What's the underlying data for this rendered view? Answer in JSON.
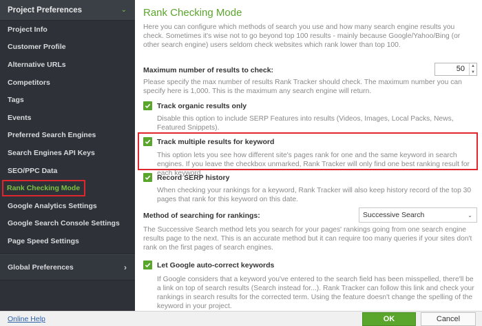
{
  "sidebar": {
    "header": "Project Preferences",
    "items": [
      {
        "label": "Project Info"
      },
      {
        "label": "Customer Profile"
      },
      {
        "label": "Alternative URLs"
      },
      {
        "label": "Competitors"
      },
      {
        "label": "Tags"
      },
      {
        "label": "Events"
      },
      {
        "label": "Preferred Search Engines"
      },
      {
        "label": "Search Engines API Keys"
      },
      {
        "label": "SEO/PPC Data"
      },
      {
        "label": "Rank Checking Mode"
      },
      {
        "label": "Google Analytics Settings"
      },
      {
        "label": "Google Search Console Settings"
      },
      {
        "label": "Page Speed Settings"
      }
    ],
    "active_item": "Rank Checking Mode",
    "global": "Global Preferences"
  },
  "main": {
    "title": "Rank Checking Mode",
    "intro": "Here you can configure which methods of search you use and how many search engine results you check. Sometimes it's wise not to go beyond top 100 results - mainly because Google/Yahoo/Bing (or other search engine) users seldom check websites which rank lower than top 100.",
    "max_results": {
      "label": "Maximum number of results to check:",
      "value": "50",
      "desc": "Please specify the max number of results Rank Tracker should check. The maximum number you can specify here is 1,000. This is the maximum any search engine will return."
    },
    "track_organic": {
      "label": "Track organic results only",
      "checked": true,
      "desc": "Disable this option to include SERP Features into results (Videos, Images, Local Packs, News, Featured Snippets)."
    },
    "track_multiple": {
      "label": "Track multiple results for keyword",
      "checked": true,
      "desc": "This option lets you see how different site's pages rank for one and the same keyword in search engines. If you leave the checkbox unmarked, Rank Tracker will only find one best ranking result for each keyword."
    },
    "record_history": {
      "label": "Record SERP history",
      "checked": true,
      "desc": "When checking your rankings for a keyword, Rank Tracker will also keep history record of the top 30 pages that rank for this keyword on this date."
    },
    "method": {
      "label": "Method of searching for rankings:",
      "selected": "Successive Search",
      "desc": "The Successive Search method lets you search for your pages' rankings going from one search engine results page to the next. This is an accurate method but it can require too many queries if your sites don't rank on the first pages of search engines."
    },
    "autocorrect": {
      "label": "Let Google auto-correct keywords",
      "checked": true,
      "desc": "If Google considers that a keyword you've entered to the search field has been misspelled, there'll be a link on top of search results (Search instead for...). Rank Tracker can follow this link and check your rankings in search results for the corrected term. Using the feature doesn't change the spelling of the keyword in your project."
    }
  },
  "footer": {
    "help": "Online Help",
    "ok": "OK",
    "cancel": "Cancel"
  },
  "colors": {
    "accent": "#5aa52c",
    "highlight": "#e0262c",
    "sidebar_bg": "#2e3238"
  }
}
